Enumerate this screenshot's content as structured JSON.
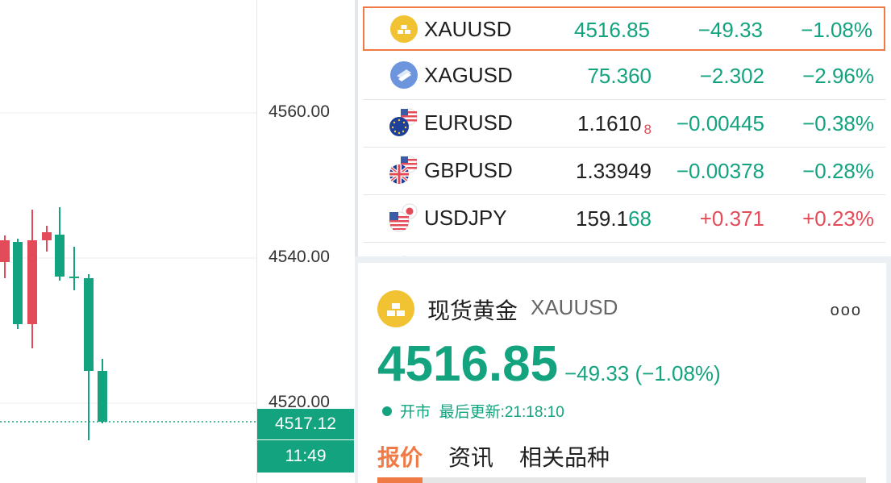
{
  "axis": {
    "ticks": [
      "4560.00",
      "4540.00",
      "4520.00"
    ],
    "current_price": "4517.12",
    "countdown": "11:49"
  },
  "watchlist": [
    {
      "symbol": "XAUUSD",
      "price": "4516.85",
      "price_small": "",
      "change": "−49.33",
      "percent": "−1.08%",
      "dir": "down",
      "selected": true,
      "icon": "gold-bars-icon"
    },
    {
      "symbol": "XAGUSD",
      "price": "75.360",
      "price_small": "",
      "change": "−2.302",
      "percent": "−2.96%",
      "dir": "down",
      "selected": false,
      "icon": "silver-bars-icon"
    },
    {
      "symbol": "EURUSD",
      "price": "1.1610",
      "price_small": "8",
      "change": "−0.00445",
      "percent": "−0.38%",
      "dir": "down",
      "selected": false,
      "icon": "eu-us-flag-icon"
    },
    {
      "symbol": "GBPUSD",
      "price": "1.33949",
      "price_small": "",
      "change": "−0.00378",
      "percent": "−0.28%",
      "dir": "down",
      "selected": false,
      "icon": "uk-us-flag-icon"
    },
    {
      "symbol": "USDJPY",
      "price": "159.1",
      "price_green": "68",
      "price_small": "",
      "change": "+0.371",
      "percent": "+0.23%",
      "dir": "up",
      "selected": false,
      "icon": "us-jp-flag-icon"
    }
  ],
  "detail": {
    "name_cn": "现货黄金",
    "symbol": "XAUUSD",
    "more": "ooo",
    "last_price": "4516.85",
    "change_text": "−49.33 (−1.08%)",
    "status": "开市",
    "updated_label": "最后更新:",
    "updated_time": "21:18:10",
    "tabs": [
      "报价",
      "资讯",
      "相关品种"
    ]
  },
  "colors": {
    "up": "#e34b58",
    "down": "#14a37f",
    "accent": "#f07a45"
  }
}
